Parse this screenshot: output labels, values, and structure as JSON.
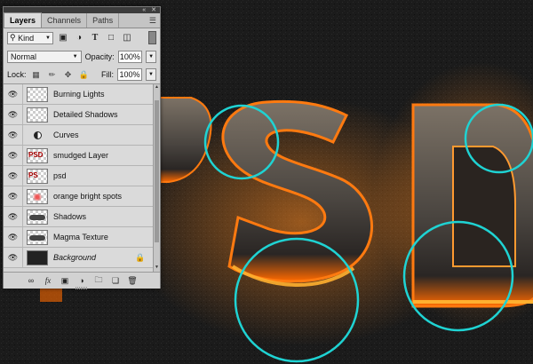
{
  "artwork": {
    "letters": [
      "P",
      "S",
      "D"
    ],
    "glow_color": "#ff7a10",
    "ring_color": "#1fd3d3"
  },
  "panel": {
    "header_icons": [
      "collapse-icon",
      "close-icon"
    ],
    "tabs": [
      {
        "label": "Layers",
        "active": true
      },
      {
        "label": "Channels",
        "active": false
      },
      {
        "label": "Paths",
        "active": false
      }
    ],
    "filter": {
      "kind_label": "Kind",
      "filter_icons": [
        "image-filter-icon",
        "adjustment-filter-icon",
        "type-filter-icon",
        "shape-filter-icon",
        "smart-object-filter-icon"
      ]
    },
    "blend_mode": "Normal",
    "opacity_label": "Opacity:",
    "opacity_value": "100%",
    "lock_label": "Lock:",
    "fill_label": "Fill:",
    "fill_value": "100%",
    "layers": [
      {
        "name": "Burning Lights",
        "thumb": "transparent",
        "visible": true
      },
      {
        "name": "Detailed Shadows",
        "thumb": "transparent",
        "visible": true
      },
      {
        "name": "Curves",
        "thumb": "adjustment",
        "visible": true
      },
      {
        "name": "smudged Layer",
        "thumb": "text",
        "thumb_text": "PSD",
        "visible": true
      },
      {
        "name": "psd",
        "thumb": "text",
        "thumb_text": "PS",
        "visible": true
      },
      {
        "name": "orange bright spots",
        "thumb": "red",
        "visible": true
      },
      {
        "name": "Shadows",
        "thumb": "dark-stroke",
        "visible": true
      },
      {
        "name": "Magma Texture",
        "thumb": "dark-stroke",
        "visible": true
      },
      {
        "name": "Background",
        "thumb": "dark",
        "visible": true,
        "locked": true
      }
    ],
    "bottom_icons": [
      "link-icon",
      "fx-icon",
      "mask-icon",
      "adjustment-icon",
      "group-icon",
      "new-layer-icon",
      "trash-icon"
    ],
    "fx_label": "fx"
  }
}
